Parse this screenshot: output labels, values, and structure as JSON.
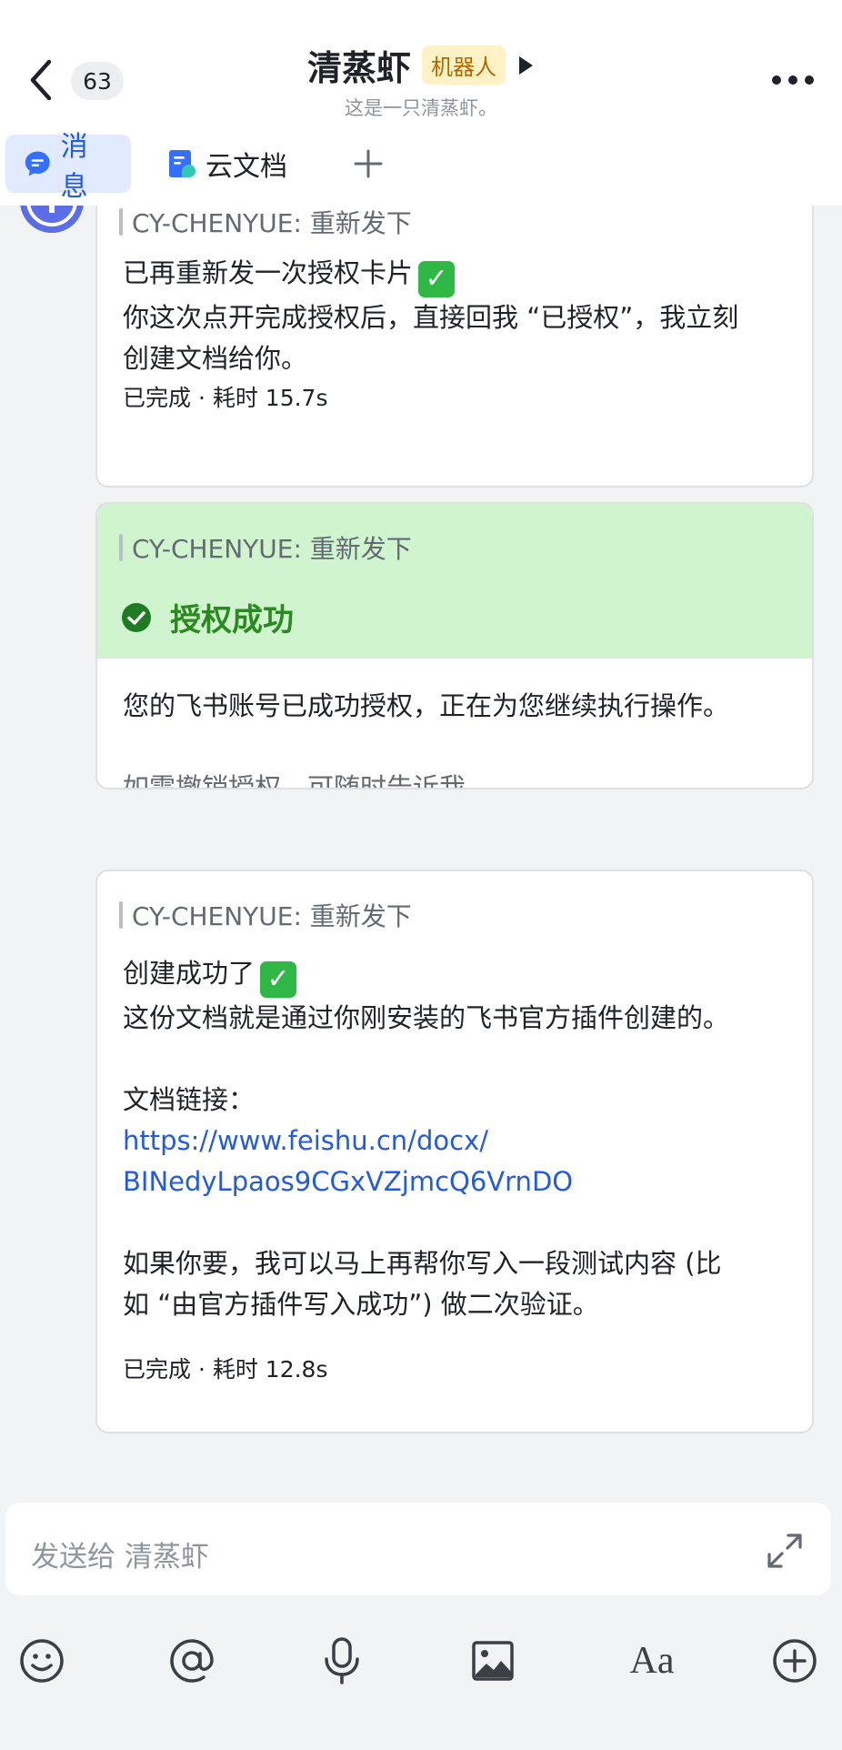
{
  "header": {
    "unread_count": "63",
    "title": "清蒸虾",
    "bot_tag": "机器人",
    "subtitle": "这是一只清蒸虾。"
  },
  "tabs": [
    {
      "label": "消息",
      "icon": "chat-bubble-icon",
      "active": true
    },
    {
      "label": "云文档",
      "icon": "doc-icon",
      "active": false
    }
  ],
  "messages": [
    {
      "quote": "CY-CHENYUE: 重新发下",
      "lines": [
        "已再重新发一次授权卡片",
        "你这次点开完成授权后，直接回我 “已授权”，我立刻",
        "创建文档给你。"
      ],
      "meta": "已完成 · 耗时 15.7s"
    },
    {
      "quote": "CY-CHENYUE: 重新发下",
      "status": "授权成功",
      "text": "您的飞书账号已成功授权，正在为您继续执行操作。",
      "note": "如需撤销授权，可随时告诉我。"
    },
    {
      "quote": "CY-CHENYUE: 重新发下",
      "line1": "创建成功了",
      "line2": "这份文档就是通过你刚安装的飞书官方插件创建的。",
      "link_label": "文档链接：",
      "link_part1": "https://www.feishu.cn/docx/",
      "link_part2": "BINedyLpaos9CGxVZjmcQ6VrnDO",
      "line3": "如果你要，我可以马上再帮你写入一段测试内容 (比",
      "line4": "如 “由官方插件写入成功”) 做二次验证。",
      "meta": "已完成 · 耗时 12.8s"
    }
  ],
  "composer": {
    "placeholder": "发送给 清蒸虾",
    "font_button": "Aa"
  },
  "colors": {
    "accent": "#245bdb",
    "success_bg": "#d0f5ce",
    "success_text": "#2a8a1f",
    "bot_tag_bg": "#fff2c7"
  }
}
